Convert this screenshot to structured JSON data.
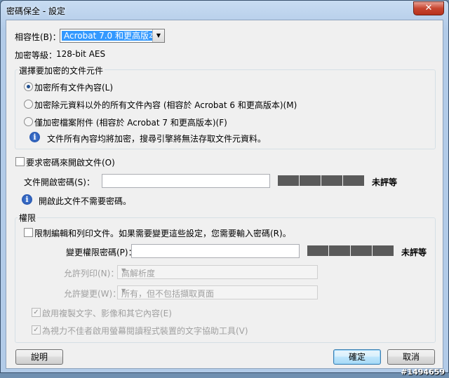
{
  "window": {
    "title": "密碼保全 - 設定",
    "close_glyph": "✕"
  },
  "compat": {
    "label": "相容性(B)：",
    "value": "Acrobat 7.0 和更高版本"
  },
  "encryption": {
    "label": "加密等級：",
    "value": "128-bit AES"
  },
  "components": {
    "legend": "選擇要加密的文件元件",
    "option_all": "加密所有文件內容(L)",
    "option_except_meta": "加密除元資料以外的所有文件內容 (相容於 Acrobat 6 和更高版本)(M)",
    "option_attachments": "僅加密檔案附件 (相容於 Acrobat 7 和更高版本)(F)",
    "selected": "option_all",
    "info": "文件所有內容均將加密，搜尋引擎將無法存取文件元資料。"
  },
  "open_password": {
    "checkbox_label": "要求密碼來開啟文件(O)",
    "checked": false,
    "field_label": "文件開啟密碼(S)：",
    "field_value": "",
    "strength": "未評等",
    "info": "開啟此文件不需要密碼。"
  },
  "permissions": {
    "legend": "權限",
    "restrict_label": "限制編輯和列印文件。如果需要變更這些設定，您需要輸入密碼(R)。",
    "restrict_checked": false,
    "change_pw_label": "變更權限密碼(P)：",
    "change_pw_value": "",
    "strength": "未評等",
    "print_label": "允許列印(N)：",
    "print_value": "高解析度",
    "change_label": "允許變更(W)：",
    "change_value": "所有，但不包括擷取頁面",
    "copy_label": "啟用複製文字、影像和其它內容(E)",
    "copy_checked": true,
    "access_label": "為視力不佳者啟用螢幕閱讀程式裝置的文字協助工具(V)",
    "access_checked": true
  },
  "buttons": {
    "help": "說明",
    "ok": "確定",
    "cancel": "取消"
  },
  "icons": {
    "info": "info-icon",
    "dropdown": "chevron-down-icon",
    "check": "✓"
  },
  "watermark": "#1494659"
}
